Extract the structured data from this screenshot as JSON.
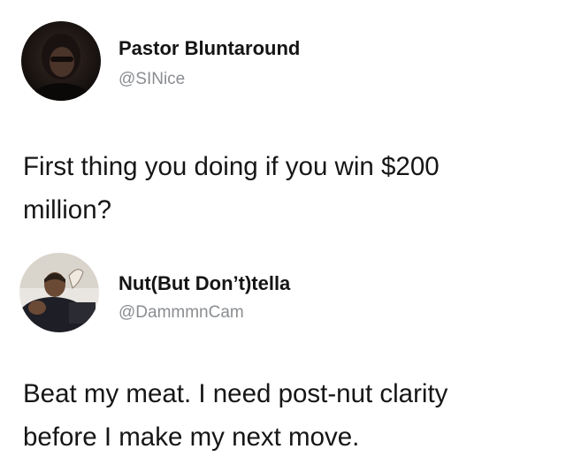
{
  "tweets": [
    {
      "author": {
        "display_name": "Pastor Bluntaround",
        "handle": "@SINice",
        "avatar_icon": "user-avatar"
      },
      "text": "First thing you doing if you win $200\nmillion?"
    },
    {
      "author": {
        "display_name": "Nut(But Don’t)tella",
        "handle": "@DammmnCam",
        "avatar_icon": "user-avatar"
      },
      "text": "Beat my meat. I need post-nut clarity\nbefore I make my next move."
    }
  ]
}
